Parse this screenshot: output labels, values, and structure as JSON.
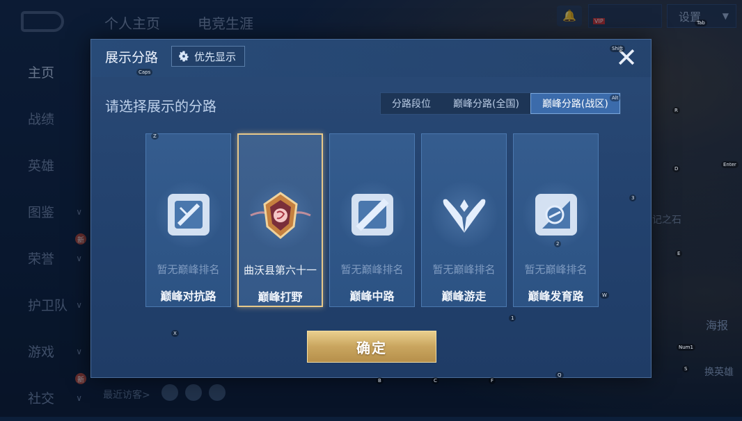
{
  "top_tabs": [
    "个人主页",
    "电竞生涯"
  ],
  "settings_label": "设置",
  "left_nav": [
    {
      "label": "主页",
      "active": true,
      "chevron": false,
      "new": false
    },
    {
      "label": "战绩",
      "active": false,
      "chevron": false,
      "new": false
    },
    {
      "label": "英雄",
      "active": false,
      "chevron": false,
      "new": false
    },
    {
      "label": "图鉴",
      "active": false,
      "chevron": true,
      "new": false
    },
    {
      "label": "荣誉",
      "active": false,
      "chevron": true,
      "new": true
    },
    {
      "label": "护卫队",
      "active": false,
      "chevron": true,
      "new": false
    },
    {
      "label": "游戏",
      "active": false,
      "chevron": true,
      "new": false
    },
    {
      "label": "社交",
      "active": false,
      "chevron": true,
      "new": true
    }
  ],
  "new_badge": "新",
  "vip_tag": "VIP",
  "recent_visitors_label": "最近访客>",
  "poster_label": "海报",
  "swap_hero_label": "换英雄",
  "stone_label": "记之石",
  "dialog": {
    "title": "展示分路",
    "priority_label": "优先显示",
    "close": "✕",
    "subtitle": "请选择展示的分路",
    "tabs": [
      {
        "label": "分路段位",
        "selected": false
      },
      {
        "label": "巅峰分路(全国)",
        "selected": false
      },
      {
        "label": "巅峰分路(战区)",
        "selected": true
      }
    ],
    "cards": [
      {
        "name": "巅峰对抗路",
        "rank": "暂无巅峰排名",
        "icon": "sword-shield-icon",
        "selected": false
      },
      {
        "name": "巅峰打野",
        "rank": "曲沃县第六十一",
        "icon": "jungle-badge-icon",
        "selected": true
      },
      {
        "name": "巅峰中路",
        "rank": "暂无巅峰排名",
        "icon": "mid-lane-icon",
        "selected": false
      },
      {
        "name": "巅峰游走",
        "rank": "暂无巅峰排名",
        "icon": "wings-icon",
        "selected": false
      },
      {
        "name": "巅峰发育路",
        "rank": "暂无巅峰排名",
        "icon": "bottom-lane-icon",
        "selected": false
      }
    ],
    "confirm_label": "确定"
  },
  "key_hints": [
    "Caps",
    "Z",
    "X",
    "Shift",
    "Alt",
    "Tab",
    "R",
    "D",
    "Enter",
    "3",
    "2",
    "E",
    "W",
    "1",
    "Num1",
    "S",
    "Q",
    "B",
    "C",
    "F"
  ],
  "colors": {
    "accent_gold": "#e9cf8d",
    "selected_tab": "#3b6bab",
    "dialog_bg": "#2a4a76"
  }
}
